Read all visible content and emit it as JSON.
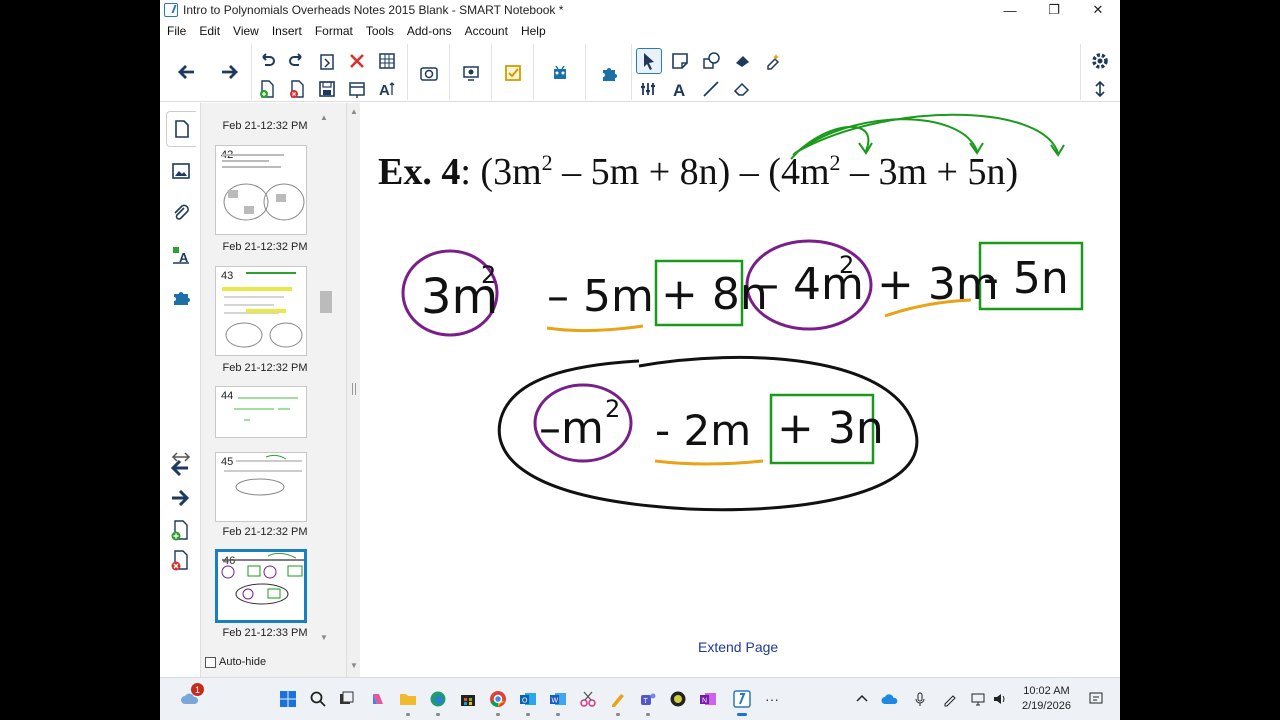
{
  "window": {
    "title": "Intro to Polynomials Overheads Notes 2015 Blank - SMART Notebook *",
    "controls": [
      "—",
      "❐",
      "✕"
    ]
  },
  "menu": [
    "File",
    "Edit",
    "View",
    "Insert",
    "Format",
    "Tools",
    "Add-ons",
    "Account",
    "Help"
  ],
  "sorter": {
    "pages": [
      {
        "num": "",
        "timestamp": "Feb 21-12:32 PM"
      },
      {
        "num": "42",
        "timestamp": "Feb 21-12:32 PM"
      },
      {
        "num": "43",
        "timestamp": "Feb 21-12:32 PM"
      },
      {
        "num": "44",
        "timestamp": ""
      },
      {
        "num": "45",
        "timestamp": "Feb 21-12:32 PM"
      },
      {
        "num": "46",
        "timestamp": "Feb 21-12:33 PM"
      }
    ],
    "auto_hide_label": "Auto-hide"
  },
  "canvas": {
    "title_bold": "Ex. 4",
    "title_rest": ": (3m",
    "sup1": "2",
    "mid1": " – 5m + 8n) – (4m",
    "sup2": "2",
    "mid2": " – 3m + 5n)",
    "extend_page": "Extend Page",
    "ink_row1": [
      "3m²",
      "– 5m",
      "+ 8n",
      "– 4m²",
      "+ 3m",
      "– 5n"
    ],
    "ink_row2": [
      "–m²",
      "- 2m",
      "+ 3n"
    ]
  },
  "taskbar": {
    "notification_count": "1",
    "time": "10:02 AM",
    "date": "2/19/2026"
  },
  "colors": {
    "purple": "#7a1f8a",
    "green": "#1a9a1a",
    "orange": "#e8a317",
    "accent": "#1a7fc0"
  }
}
